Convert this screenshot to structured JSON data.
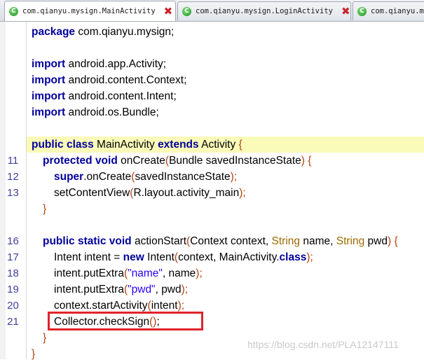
{
  "tabs": [
    {
      "label": "com.qianyu.mysign.MainActivity",
      "active": true
    },
    {
      "label": "com.qianyu.mysign.LoginActivity",
      "active": false
    },
    {
      "label": "com.qianyu.m",
      "active": false
    }
  ],
  "code": {
    "line_pkg": {
      "kw": "package",
      "rest": " com.qianyu.mysign;"
    },
    "line_imp1": {
      "kw": "import",
      "rest": " android.app.Activity;"
    },
    "line_imp2": {
      "kw": "import",
      "rest": " android.content.Context;"
    },
    "line_imp3": {
      "kw": "import",
      "rest": " android.content.Intent;"
    },
    "line_imp4": {
      "kw": "import",
      "rest": " android.os.Bundle;"
    },
    "line_class": {
      "kw1": "public",
      "kw2": "class",
      "name": " MainActivity ",
      "kw3": "extends",
      "parent": " Activity ",
      "brace": "{"
    },
    "line11": {
      "num": "11",
      "kw1": "protected",
      "kw2": "void",
      "method": " onCreate",
      "p1": "(",
      "args": "Bundle savedInstanceState",
      "p2": ")",
      "brace": " {"
    },
    "line12": {
      "num": "12",
      "kw": "super",
      "call": ".onCreate",
      "p1": "(",
      "args": "savedInstanceState",
      "p2": ");"
    },
    "line13": {
      "num": "13",
      "call": "setContentView",
      "p1": "(",
      "args": "R.layout.activity_main",
      "p2": ");"
    },
    "line14": {
      "brace": "}"
    },
    "line16": {
      "num": "16",
      "kw1": "public",
      "kw2": "static",
      "kw3": "void",
      "method": " actionStart",
      "p1": "(",
      "a1": "Context context, ",
      "t1": "String",
      "a2": " name, ",
      "t2": "String",
      "a3": " pwd",
      "p2": ")",
      "brace": " {"
    },
    "line17": {
      "num": "17",
      "start": "Intent intent = ",
      "kw": "new",
      "cls": " Intent",
      "p1": "(",
      "args": "context, MainActivity.",
      "kw2": "class",
      "p2": ");"
    },
    "line18": {
      "num": "18",
      "call": "intent.putExtra",
      "p1": "(",
      "str": "\"name\"",
      "args": ", name",
      "p2": ");"
    },
    "line19": {
      "num": "19",
      "call": "intent.putExtra",
      "p1": "(",
      "str": "\"pwd\"",
      "args": ", pwd",
      "p2": ");"
    },
    "line20": {
      "num": "20",
      "call": "context.startActivity",
      "p1": "(",
      "args": "intent",
      "p2": ");"
    },
    "line21": {
      "num": "21",
      "call": "Collector.checkSign",
      "p1": "()",
      "p2": ";"
    },
    "line22": {
      "brace": "}"
    },
    "line23": {
      "brace": "}"
    }
  },
  "watermark": "https://blog.csdn.net/PLA12147111"
}
